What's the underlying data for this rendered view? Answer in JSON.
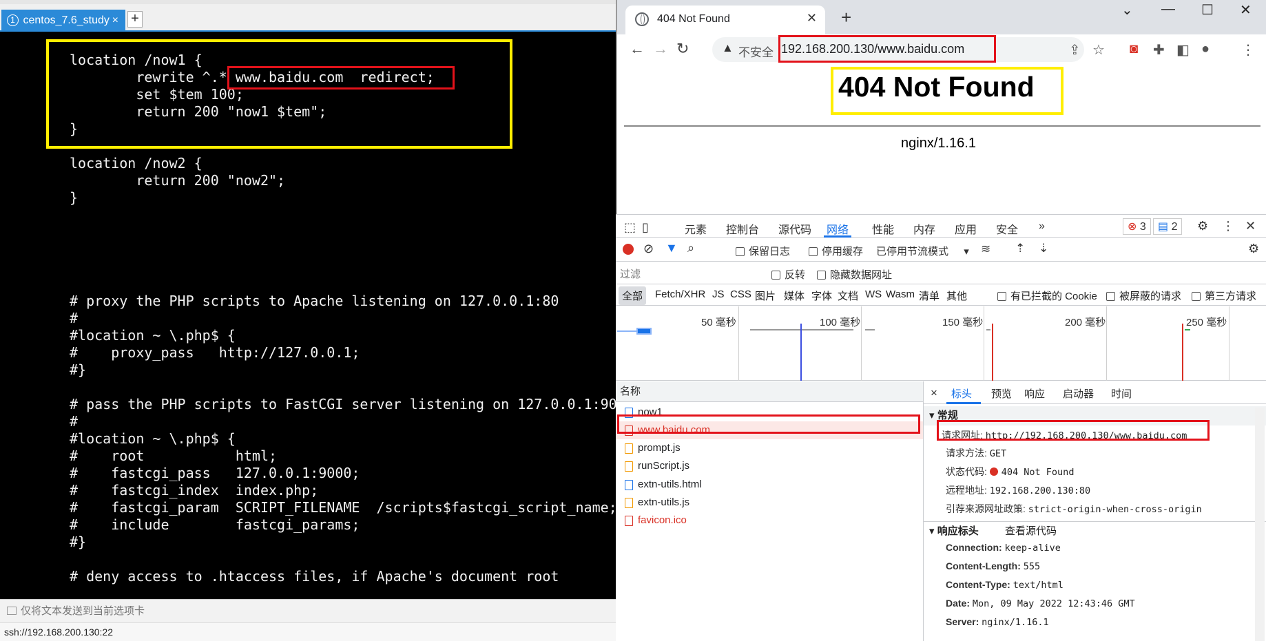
{
  "terminal": {
    "tab_number": "1",
    "tab_label": "centos_7.6_study",
    "tab_close": "×",
    "new_tab": "+",
    "code_lines": [
      "location /now1 {",
      "        rewrite ^.* www.baidu.com  redirect;",
      "        set $tem 100;",
      "        return 200 \"now1 $tem\";",
      "}",
      "location /now2 {",
      "        return 200 \"now2\";",
      "}",
      "# proxy the PHP scripts to Apache listening on 127.0.0.1:80",
      "#",
      "#location ~ \\.php$ {",
      "#    proxy_pass   http://127.0.0.1;",
      "#}",
      "# pass the PHP scripts to FastCGI server listening on 127.0.0.1:90",
      "#",
      "#location ~ \\.php$ {",
      "#    root           html;",
      "#    fastcgi_pass   127.0.0.1:9000;",
      "#    fastcgi_index  index.php;",
      "#    fastcgi_param  SCRIPT_FILENAME  /scripts$fastcgi_script_name;",
      "#    include        fastcgi_params;",
      "#}",
      "# deny access to .htaccess files, if Apache's document root"
    ],
    "send_bar": "仅将文本发送到当前选项卡",
    "status": "ssh://192.168.200.130:22"
  },
  "browser": {
    "tab_title": "404 Not Found",
    "insecure_label": "不安全",
    "url": "192.168.200.130/www.baidu.com",
    "page_heading": "404 Not Found",
    "page_server": "nginx/1.16.1"
  },
  "devtools": {
    "tabs": [
      "元素",
      "控制台",
      "源代码",
      "网络",
      "性能",
      "内存",
      "应用",
      "安全"
    ],
    "more_tabs": "»",
    "error_count": "3",
    "message_count": "2",
    "toolbar": {
      "preserve_log": "保留日志",
      "disable_cache": "停用缓存",
      "throttling": "已停用节流模式"
    },
    "filter": {
      "placeholder": "过滤",
      "invert": "反转",
      "hide_data_urls": "隐藏数据网址"
    },
    "types": [
      "全部",
      "Fetch/XHR",
      "JS",
      "CSS",
      "图片",
      "媒体",
      "字体",
      "文档",
      "WS",
      "Wasm",
      "清单",
      "其他"
    ],
    "types_checks": {
      "blocked_cookies": "有已拦截的 Cookie",
      "blocked_requests": "被屏蔽的请求",
      "third_party": "第三方请求"
    },
    "timeline_labels": [
      "50 毫秒",
      "100 毫秒",
      "150 毫秒",
      "200 毫秒",
      "250 毫秒"
    ],
    "name_header": "名称",
    "requests": [
      {
        "name": "now1",
        "kind": "doc",
        "status": "ok"
      },
      {
        "name": "www.baidu.com",
        "kind": "doc",
        "status": "error"
      },
      {
        "name": "prompt.js",
        "kind": "js",
        "status": "ok"
      },
      {
        "name": "runScript.js",
        "kind": "js",
        "status": "ok"
      },
      {
        "name": "extn-utils.html",
        "kind": "doc",
        "status": "ok"
      },
      {
        "name": "extn-utils.js",
        "kind": "js",
        "status": "ok"
      },
      {
        "name": "favicon.ico",
        "kind": "other",
        "status": "error"
      }
    ],
    "detail_tabs": {
      "close": "×",
      "headers": "标头",
      "preview": "预览",
      "response": "响应",
      "initiator": "启动器",
      "timing": "时间"
    },
    "general": {
      "title": "常规",
      "request_url_label": "请求网址:",
      "request_url": "http://192.168.200.130/www.baidu.com",
      "method_label": "请求方法:",
      "method": "GET",
      "status_label": "状态代码:",
      "status": "404 Not Found",
      "remote_label": "远程地址:",
      "remote": "192.168.200.130:80",
      "referrer_label": "引荐来源网址政策:",
      "referrer": "strict-origin-when-cross-origin"
    },
    "response_headers": {
      "title": "响应标头",
      "view_source": "查看源代码",
      "items": [
        {
          "k": "Connection:",
          "v": "keep-alive"
        },
        {
          "k": "Content-Length:",
          "v": "555"
        },
        {
          "k": "Content-Type:",
          "v": "text/html"
        },
        {
          "k": "Date:",
          "v": "Mon, 09 May 2022 12:43:46 GMT"
        },
        {
          "k": "Server:",
          "v": "nginx/1.16.1"
        }
      ]
    }
  }
}
